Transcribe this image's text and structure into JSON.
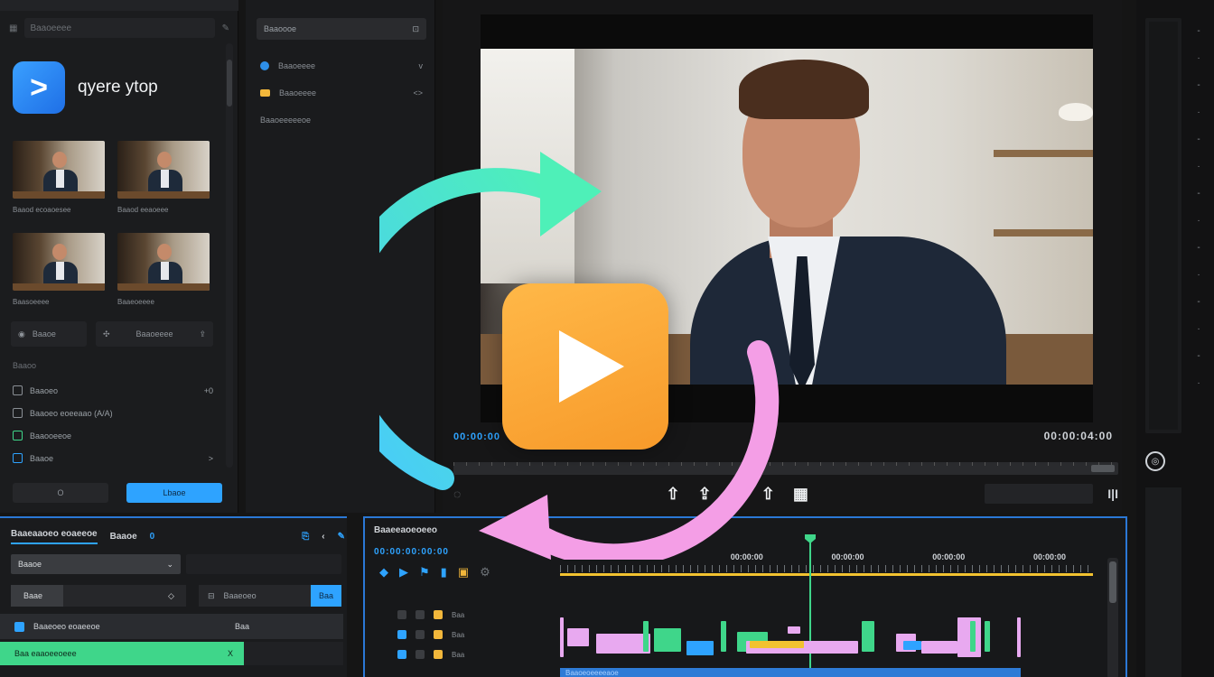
{
  "brand": {
    "name": "qyere ytop",
    "logo_glyph": ">",
    "accent": "#2ea3ff"
  },
  "left_panel": {
    "search_placeholder": "Baaoeeee",
    "thumbs": [
      {
        "label": "Baaod ecoaoesee"
      },
      {
        "label": "Baaod eeaoeee"
      },
      {
        "label": "Baasoeeee"
      },
      {
        "label": "Baaeoeeee"
      }
    ],
    "tool_a": "Baaoe",
    "tool_b": "Baaoeeee",
    "section_title": "Baaoo",
    "list": [
      {
        "label": "Baaoeo",
        "trail": "+0"
      },
      {
        "label": "Baaoeo eoeeaao (A/A)",
        "trail": ""
      },
      {
        "label": "Baaooeeoe",
        "trail": ""
      },
      {
        "label": "Baaoe",
        "trail": ">"
      }
    ],
    "btn_cancel": "O",
    "btn_primary": "Lbaoe"
  },
  "fx_panel": {
    "search": "Baaoooe",
    "rows": [
      {
        "label": "Baaoeeee",
        "trail": "v"
      },
      {
        "label": "Baaoeeee",
        "trail": "<>"
      },
      {
        "label": "Baaoeeeeeoe",
        "trail": ""
      }
    ]
  },
  "monitor": {
    "timecode_in": "00:00:00",
    "timecode_out": "00:00:04:00",
    "transport": [
      "⇧",
      "⇪",
      "⇮",
      "⇧",
      "▦"
    ],
    "right_btn": "I|I"
  },
  "props": {
    "tabs": {
      "main": "Baaeaaoeo eoaeeoe",
      "second": "Baaoe",
      "num": "0"
    },
    "select_value": "Baaoe",
    "row2_label": "Baae",
    "row2_b_label": "Baaeoeo",
    "row2_btn": "Baa",
    "row3_label": "Baaeoeo eoaeeoe",
    "row3_val": "Baa",
    "row4_label": "Baa eaaoeeoeee",
    "row4_trail": "X"
  },
  "timeline": {
    "title": "Baaeeaoeoeeo",
    "timecode": "00:00:00:00:00",
    "ruler_labels": [
      "00:00",
      "00:00:00",
      "00:00:00",
      "00:00:00",
      "00:00:00"
    ],
    "track_labels": [
      "Baa",
      "Baa",
      "Baa"
    ],
    "audio_label": "Baaoeoeeeeaoe"
  }
}
